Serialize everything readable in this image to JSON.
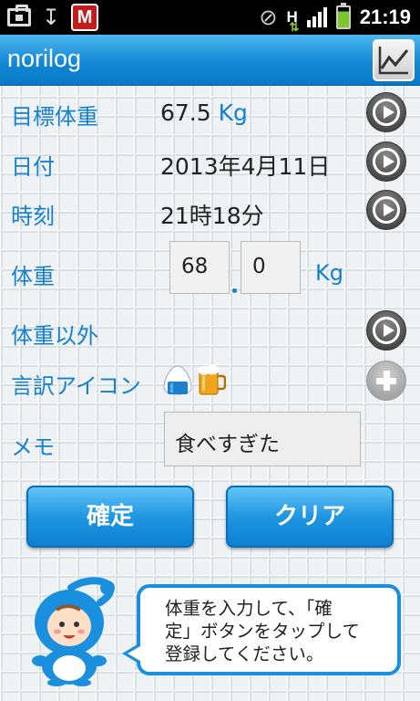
{
  "status_bar": {
    "time": "21:19",
    "network_letter": "H",
    "mcafee_letter": "M",
    "icons": [
      "briefcase-icon",
      "usb-icon",
      "mcafee-icon",
      "mute-icon",
      "hspa-icon",
      "signal-icon",
      "battery-charging-icon"
    ]
  },
  "app": {
    "title": "norilog",
    "graph_icon": "line-graph-icon"
  },
  "form": {
    "target_weight": {
      "label": "目標体重",
      "value": "67.5",
      "unit": "Kg"
    },
    "date": {
      "label": "日付",
      "value": "2013年4月11日"
    },
    "time": {
      "label": "時刻",
      "value": "21時18分"
    },
    "weight": {
      "label": "体重",
      "integer": "68",
      "decimal": "0",
      "unit": "Kg"
    },
    "other": {
      "label": "体重以外"
    },
    "excuse_icons": {
      "label": "言訳アイコン",
      "icons": [
        "rice-ball-icon",
        "beer-icon"
      ]
    },
    "memo": {
      "label": "メモ",
      "value": "食べすぎた"
    }
  },
  "buttons": {
    "confirm": "確定",
    "clear": "クリア"
  },
  "hint": {
    "line1": "体重を入力して、「確",
    "line2": "定」ボタンをタップして",
    "line3": "登録してください。"
  },
  "colors": {
    "accent": "#1680cc",
    "title_bar": "#1288d5",
    "button": "#1f96e2"
  }
}
